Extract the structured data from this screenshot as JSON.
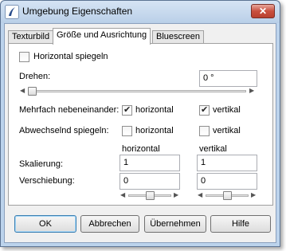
{
  "window": {
    "title": "Umgebung Eigenschaften",
    "close_glyph": "✕"
  },
  "tabs": [
    {
      "label": "Texturbild"
    },
    {
      "label": "Größe und Ausrichtung"
    },
    {
      "label": "Bluescreen"
    }
  ],
  "flip_horizontal": {
    "label": "Horizontal spiegeln",
    "checked": false
  },
  "rotate": {
    "label": "Drehen:",
    "value": "0 °"
  },
  "tiling": {
    "label": "Mehrfach nebeneinander:",
    "horizontal_label": "horizontal",
    "horizontal_checked": true,
    "vertical_label": "vertikal",
    "vertical_checked": true
  },
  "alt_mirror": {
    "label": "Abwechselnd spiegeln:",
    "horizontal_label": "horizontal",
    "horizontal_checked": false,
    "vertical_label": "vertikal",
    "vertical_checked": false
  },
  "columns": {
    "horizontal": "horizontal",
    "vertical": "vertikal"
  },
  "scale": {
    "label": "Skalierung:",
    "horizontal_value": "1",
    "vertical_value": "1"
  },
  "offset": {
    "label": "Verschiebung:",
    "horizontal_value": "0",
    "vertical_value": "0"
  },
  "buttons": {
    "ok": "OK",
    "cancel": "Abbrechen",
    "apply": "Übernehmen",
    "help": "Hilfe"
  },
  "icons": {
    "checkmark": "✔",
    "arrow_left": "◀",
    "arrow_right": "▶"
  }
}
